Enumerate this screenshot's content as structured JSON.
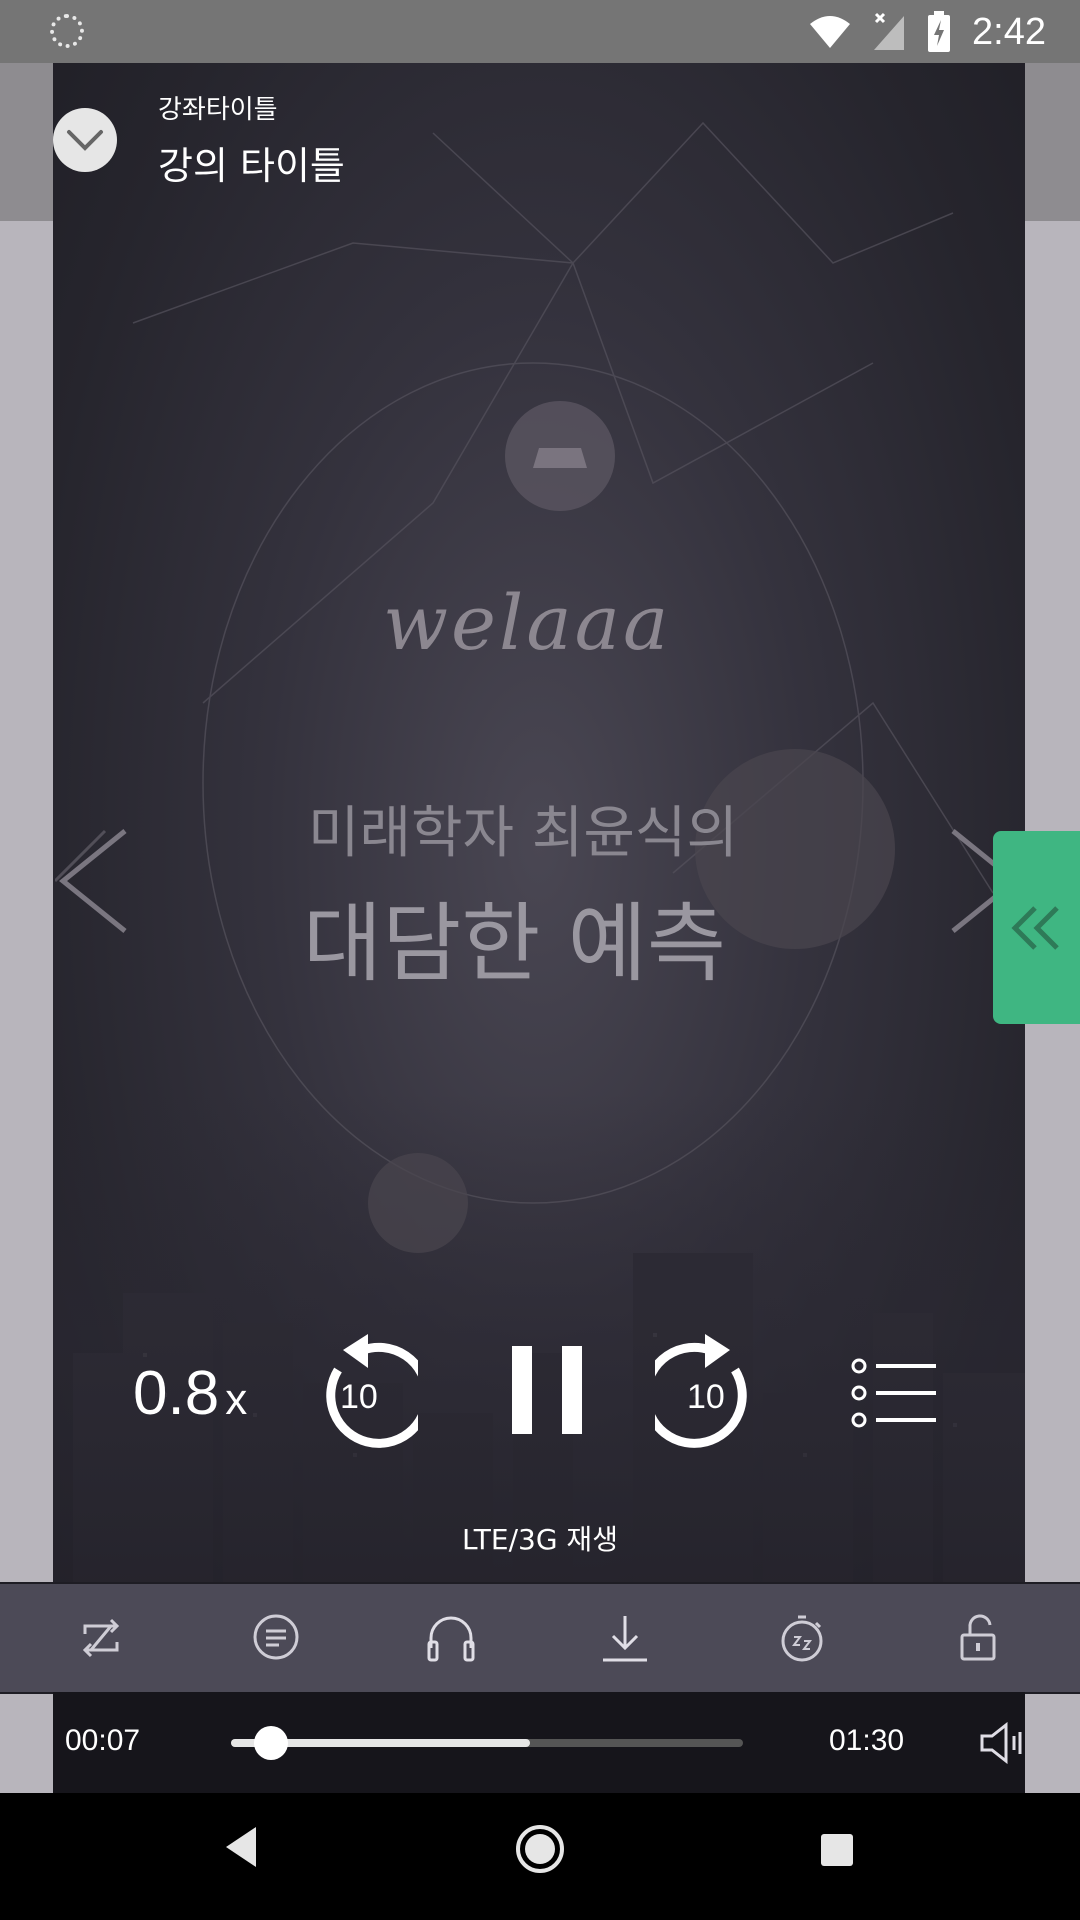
{
  "status_bar": {
    "time": "2:42",
    "icons": [
      "loading-icon",
      "wifi-icon",
      "cell-signal-icon",
      "battery-charging-icon"
    ]
  },
  "header": {
    "course_title": "강좌타이틀",
    "lecture_title": "강의 타이틀",
    "collapse_icon": "chevron-down-icon"
  },
  "artwork": {
    "logo": "welaaa",
    "subtitle": "미래학자 최윤식의",
    "title": "대담한 예측"
  },
  "controls": {
    "speed_value": "0.8",
    "speed_suffix": "x",
    "rewind_seconds": "10",
    "forward_seconds": "10",
    "play_state": "pause",
    "playlist_icon": "playlist-icon"
  },
  "network_label": "LTE/3G 재생",
  "toolbar": {
    "items": [
      "repeat-icon",
      "comment-icon",
      "headphones-icon",
      "download-icon",
      "sleep-timer-icon",
      "lock-icon"
    ]
  },
  "progress": {
    "current_time": "00:07",
    "total_time": "01:30",
    "played_fraction": 0.078,
    "buffered_fraction": 0.584
  },
  "colors": {
    "accent_green": "#3fb682",
    "status_bar": "#757575",
    "toolbar": "#4c4a57"
  }
}
